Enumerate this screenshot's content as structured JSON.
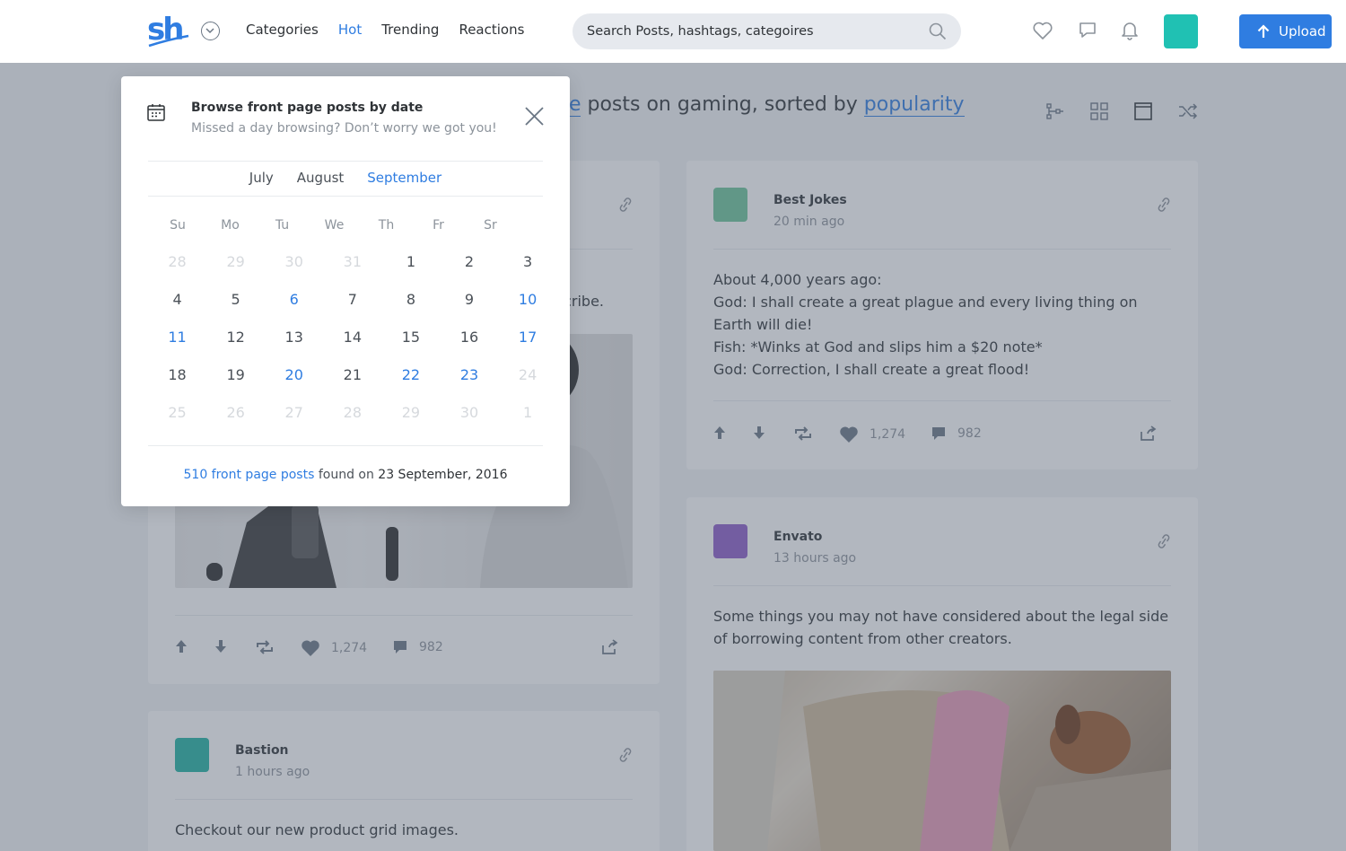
{
  "header": {
    "logo_text": "sh",
    "nav": [
      {
        "label": "Categories",
        "active": false
      },
      {
        "label": "Hot",
        "active": true
      },
      {
        "label": "Trending",
        "active": false
      },
      {
        "label": "Reactions",
        "active": false
      }
    ],
    "search_placeholder": "Search Posts, hashtags, categoires",
    "upload_label": "Upload",
    "icons": [
      "heart-icon",
      "chat-icon",
      "bell-icon"
    ],
    "accent_color": "#2f7de1",
    "avatar_color": "#20c1b3"
  },
  "page": {
    "title_fragment_link": "ne",
    "title_text": " posts on gaming, sorted by ",
    "title_sort_link": "popularity"
  },
  "cards": {
    "left_top": {
      "body_fragment": "cribe.",
      "stats": {
        "likes": "1,274",
        "comments": "982"
      }
    },
    "best_jokes": {
      "name": "Best Jokes",
      "time": "20 min ago",
      "avatar_color": "#6cc59a",
      "lines": [
        "About 4,000 years ago:",
        "God: I shall create a great plague and every living thing on Earth will die!",
        "Fish: *Winks at God and slips him a $20 note*",
        "God: Correction, I shall create a great flood!"
      ],
      "stats": {
        "likes": "1,274",
        "comments": "982"
      }
    },
    "envato": {
      "name": "Envato",
      "time": "13 hours ago",
      "avatar_color": "#8d5cc9",
      "body": "Some things you may not have considered about the legal side of borrowing content from other creators."
    },
    "bastion": {
      "name": "Bastion",
      "time": "1 hours ago",
      "avatar_color": "#20b3a3",
      "body": "Checkout our new product grid images."
    }
  },
  "popup": {
    "title": "Browse front page posts by date",
    "subtitle": "Missed a day browsing? Don’t worry we got you!",
    "months": [
      {
        "label": "July",
        "active": false
      },
      {
        "label": "August",
        "active": false
      },
      {
        "label": "September",
        "active": true
      }
    ],
    "weekdays": [
      "Su",
      "Mo",
      "Tu",
      "We",
      "Th",
      "Fr",
      "Sr"
    ],
    "weeks": [
      [
        {
          "d": "28",
          "s": "muted"
        },
        {
          "d": "29",
          "s": "muted"
        },
        {
          "d": "30",
          "s": "muted"
        },
        {
          "d": "31",
          "s": "muted"
        },
        {
          "d": "1",
          "s": ""
        },
        {
          "d": "2",
          "s": ""
        },
        {
          "d": "3",
          "s": ""
        }
      ],
      [
        {
          "d": "4",
          "s": ""
        },
        {
          "d": "5",
          "s": ""
        },
        {
          "d": "6",
          "s": "hl"
        },
        {
          "d": "7",
          "s": ""
        },
        {
          "d": "8",
          "s": ""
        },
        {
          "d": "9",
          "s": ""
        },
        {
          "d": "10",
          "s": "hl"
        }
      ],
      [
        {
          "d": "11",
          "s": "hl"
        },
        {
          "d": "12",
          "s": ""
        },
        {
          "d": "13",
          "s": ""
        },
        {
          "d": "14",
          "s": ""
        },
        {
          "d": "15",
          "s": ""
        },
        {
          "d": "16",
          "s": ""
        },
        {
          "d": "17",
          "s": "hl"
        }
      ],
      [
        {
          "d": "18",
          "s": ""
        },
        {
          "d": "19",
          "s": ""
        },
        {
          "d": "20",
          "s": "hl"
        },
        {
          "d": "21",
          "s": ""
        },
        {
          "d": "22",
          "s": "hl"
        },
        {
          "d": "23",
          "s": "hl"
        },
        {
          "d": "24",
          "s": "muted"
        }
      ],
      [
        {
          "d": "25",
          "s": "muted"
        },
        {
          "d": "26",
          "s": "muted"
        },
        {
          "d": "27",
          "s": "muted"
        },
        {
          "d": "28",
          "s": "muted"
        },
        {
          "d": "29",
          "s": "muted"
        },
        {
          "d": "30",
          "s": "muted"
        },
        {
          "d": "1",
          "s": "muted"
        }
      ]
    ],
    "footer_link": "510 front page posts",
    "footer_mid": " found on ",
    "footer_date": "23 September, 2016"
  }
}
